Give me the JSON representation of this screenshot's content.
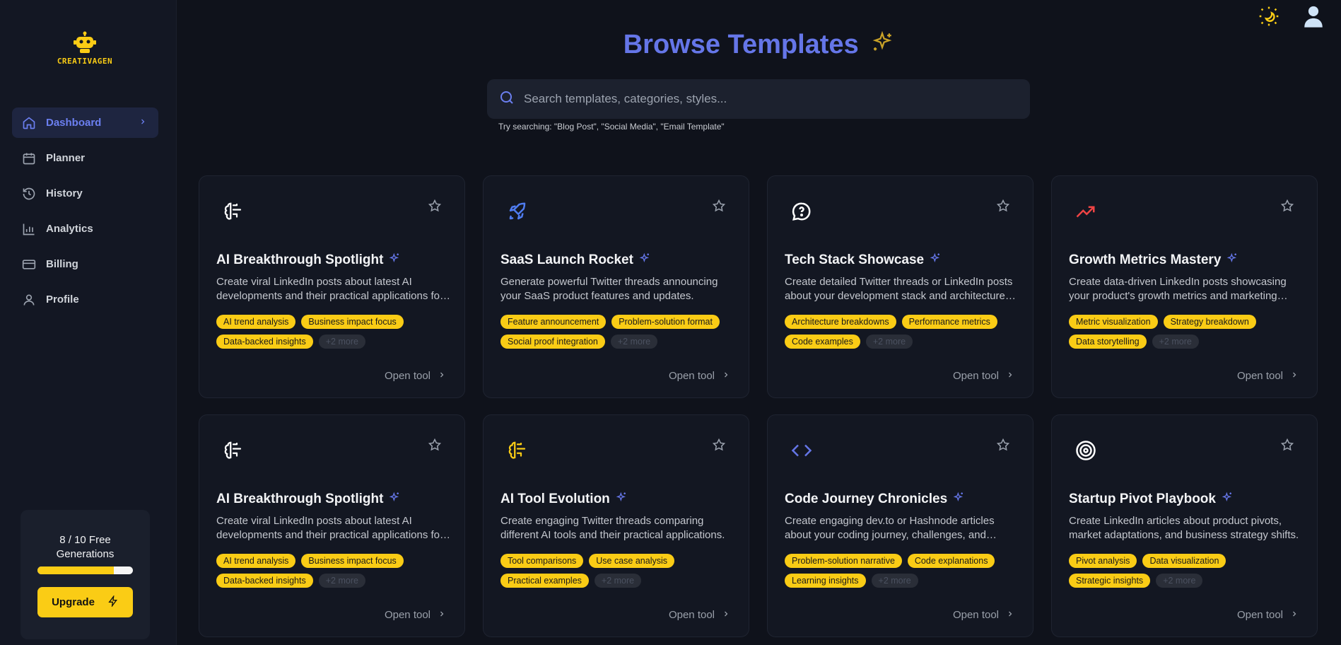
{
  "brand": {
    "name": "CREATIVAGEN"
  },
  "sidebar": {
    "items": [
      {
        "label": "Dashboard",
        "icon": "home-icon"
      },
      {
        "label": "Planner",
        "icon": "calendar-icon"
      },
      {
        "label": "History",
        "icon": "history-icon"
      },
      {
        "label": "Analytics",
        "icon": "chart-icon"
      },
      {
        "label": "Billing",
        "icon": "card-icon"
      },
      {
        "label": "Profile",
        "icon": "user-icon"
      }
    ],
    "active": "Dashboard"
  },
  "usage": {
    "text": "8 / 10 Free Generations",
    "used": 8,
    "total": 10,
    "upgrade_label": "Upgrade"
  },
  "header": {
    "title": "Browse Templates",
    "search_placeholder": "Search templates, categories, styles...",
    "hint": "Try searching: \"Blog Post\", \"Social Media\", \"Email Template\""
  },
  "colors": {
    "accent": "#6576e8",
    "yellow": "#facc15",
    "bg": "#0f121b"
  },
  "cards": [
    {
      "icon": "brain-icon",
      "icon_color": "#ffffff",
      "title": "AI Breakthrough Spotlight",
      "desc": "Create viral LinkedIn posts about latest AI developments and their practical applications for businesses.",
      "tags": [
        "AI trend analysis",
        "Business impact focus",
        "Data-backed insights"
      ],
      "more": "+2 more",
      "open": "Open tool"
    },
    {
      "icon": "rocket-icon",
      "icon_color": "#4f7cf0",
      "title": "SaaS Launch Rocket",
      "desc": "Generate powerful Twitter threads announcing your SaaS product features and updates.",
      "tags": [
        "Feature announcement",
        "Problem-solution format",
        "Social proof integration"
      ],
      "more": "+2 more",
      "open": "Open tool"
    },
    {
      "icon": "message-question-icon",
      "icon_color": "#ffffff",
      "title": "Tech Stack Showcase",
      "desc": "Create detailed Twitter threads or LinkedIn posts about your development stack and architecture decisions.",
      "tags": [
        "Architecture breakdowns",
        "Performance metrics",
        "Code examples"
      ],
      "more": "+2 more",
      "open": "Open tool"
    },
    {
      "icon": "trending-up-icon",
      "icon_color": "#ef4444",
      "title": "Growth Metrics Mastery",
      "desc": "Create data-driven LinkedIn posts showcasing your product's growth metrics and marketing strategies.",
      "tags": [
        "Metric visualization",
        "Strategy breakdown",
        "Data storytelling"
      ],
      "more": "+2 more",
      "open": "Open tool"
    },
    {
      "icon": "brain-icon",
      "icon_color": "#ffffff",
      "title": "AI Breakthrough Spotlight",
      "desc": "Create viral LinkedIn posts about latest AI developments and their practical applications for businesses.",
      "tags": [
        "AI trend analysis",
        "Business impact focus",
        "Data-backed insights"
      ],
      "more": "+2 more",
      "open": "Open tool"
    },
    {
      "icon": "brain-icon",
      "icon_color": "#facc15",
      "title": "AI Tool Evolution",
      "desc": "Create engaging Twitter threads comparing different AI tools and their practical applications.",
      "tags": [
        "Tool comparisons",
        "Use case analysis",
        "Practical examples"
      ],
      "more": "+2 more",
      "open": "Open tool"
    },
    {
      "icon": "code-icon",
      "icon_color": "#6576e8",
      "title": "Code Journey Chronicles",
      "desc": "Create engaging dev.to or Hashnode articles about your coding journey, challenges, and solutions.",
      "tags": [
        "Problem-solution narrative",
        "Code explanations",
        "Learning insights"
      ],
      "more": "+2 more",
      "open": "Open tool"
    },
    {
      "icon": "target-icon",
      "icon_color": "#ffffff",
      "title": "Startup Pivot Playbook",
      "desc": "Create LinkedIn articles about product pivots, market adaptations, and business strategy shifts.",
      "tags": [
        "Pivot analysis",
        "Data visualization",
        "Strategic insights"
      ],
      "more": "+2 more",
      "open": "Open tool"
    }
  ]
}
